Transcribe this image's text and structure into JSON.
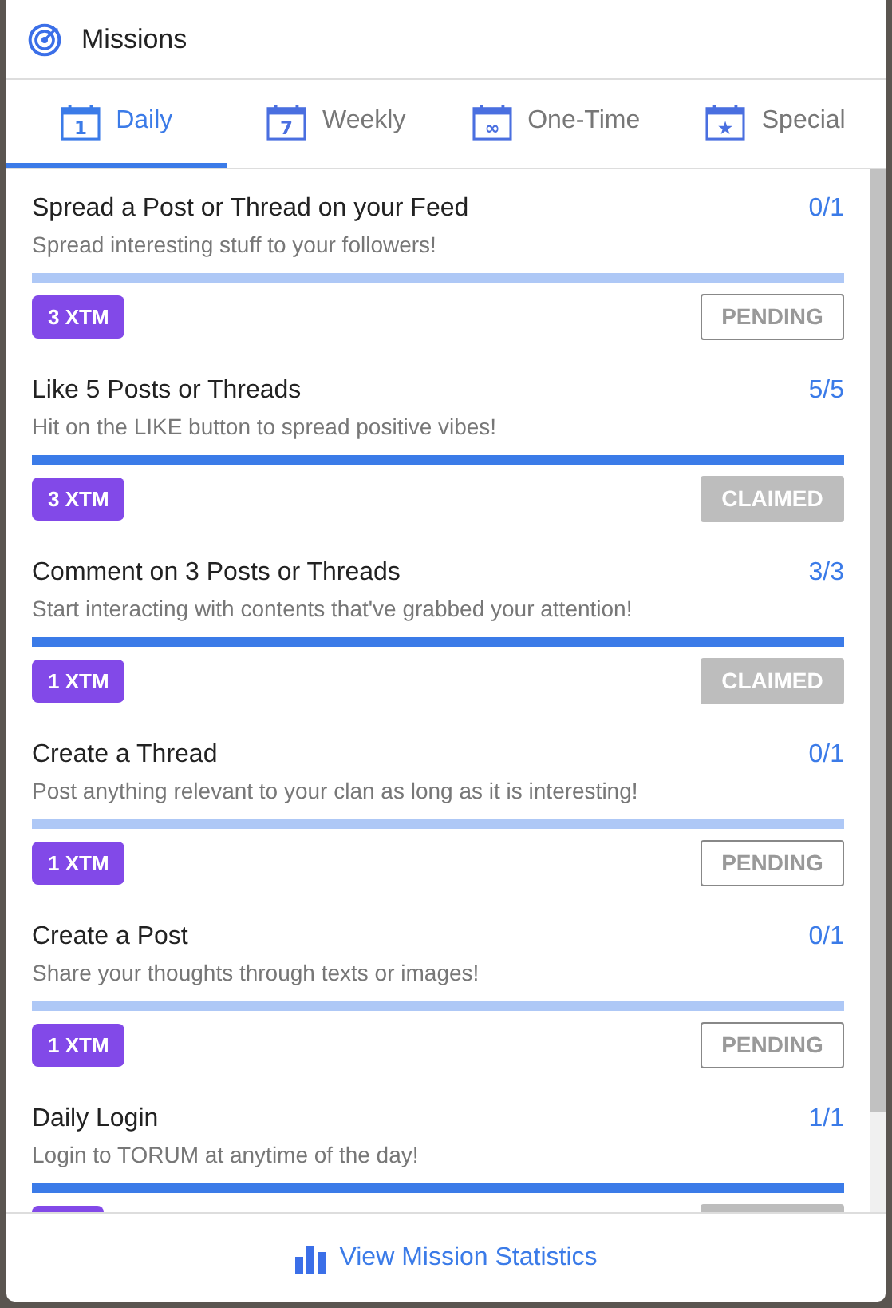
{
  "window": {
    "title": "Missions"
  },
  "tabs": [
    {
      "label": "Daily",
      "icon_text": "1",
      "selected": true
    },
    {
      "label": "Weekly",
      "icon_text": "7",
      "selected": false
    },
    {
      "label": "One-Time",
      "icon_text": "∞",
      "selected": false
    },
    {
      "label": "Special",
      "icon_text": "★",
      "selected": false
    }
  ],
  "missions": [
    {
      "title": "Spread a Post or Thread on your Feed",
      "description": "Spread interesting stuff to your followers!",
      "count": "0/1",
      "level": 0,
      "reward": "3 XTM",
      "claimed": false,
      "status": "PENDING"
    },
    {
      "title": "Like 5 Posts or Threads",
      "description": "Hit on the LIKE button to spread positive vibes!",
      "count": "5/5",
      "level": 1,
      "reward": "3 XTM",
      "claimed": true,
      "status": "CLAIMED"
    },
    {
      "title": "Comment on 3 Posts or Threads",
      "description": "Start interacting with contents that've grabbed your attention!",
      "count": "3/3",
      "level": 1,
      "reward": "1 XTM",
      "claimed": true,
      "status": "CLAIMED"
    },
    {
      "title": "Create a Thread",
      "description": "Post anything relevant to your clan as long as it is interesting!",
      "count": "0/1",
      "level": 0,
      "reward": "1 XTM",
      "claimed": false,
      "status": "PENDING"
    },
    {
      "title": "Create a Post",
      "description": "Share your thoughts through texts or images!",
      "count": "0/1",
      "level": 0,
      "reward": "1 XTM",
      "claimed": false,
      "status": "PENDING"
    },
    {
      "title": "Daily Login",
      "description": "Login to TORUM at anytime of the day!",
      "count": "1/1",
      "level": 1,
      "claimed": true
    }
  ],
  "footer": {
    "link": "View Mission Statistics"
  }
}
